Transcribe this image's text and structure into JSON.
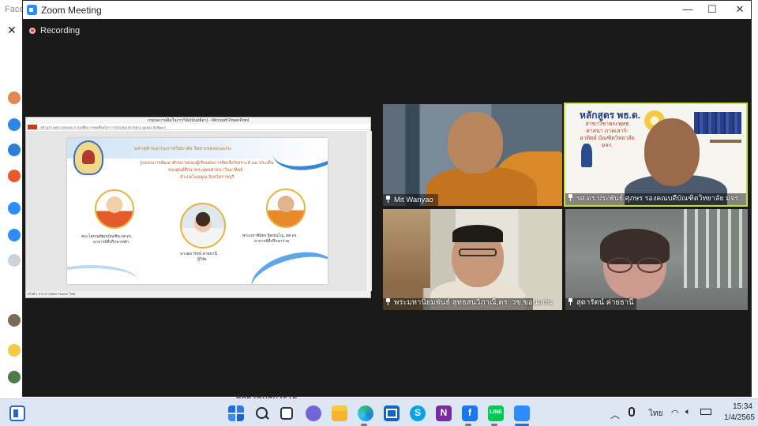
{
  "window": {
    "title": "Zoom Meeting",
    "minimize": "—",
    "maximize": "☐",
    "close": "✕"
  },
  "recording": {
    "label": "Recording"
  },
  "background": {
    "tab_text": "Faceb",
    "close": "✕",
    "bottom_text": "หลอรัชกลีกระโจ"
  },
  "shared_screen": {
    "app_title": "กรอบความคิดในการวิจัย(นันทธิดา) - Microsoft PowerPoint",
    "ribbon_tabs": "หน้าแรก   แทรก   ออกแบบ   การเปลี่ยน   ภาพเคลื่อนไหว   การนำเสนอ   ตรวจทาน   มุมมอง   นักพัฒนา",
    "status": "สไลด์ 1 จาก 8   \"Office Theme\"   ไทย",
    "slide": {
      "header": "มหาจุฬาลงกรณราชวิทยาลัย วิทยาเขตขอนแก่น",
      "line1": "รูปแบบการพัฒนาศักยภาพของผู้เรียนต่อการคิดเชิงวิเคราะห์ ๔๓ ประเด็น",
      "line2": "ของศูนย์ศึกษาพระพุทธศาสนาวันอาทิตย์",
      "line3": "อำเภอโนนคูณ จังหวัดราชบุรี",
      "person1_name": "พระโสภณพัฒนบัณฑิต,รศ.ดร.",
      "person1_role": "อาจารย์ที่ปรึกษาหลัก",
      "person2_name": "นางสุดารัตน์ ค่ายธานี",
      "person2_role": "ผู้วิจัย",
      "person3_name": "พระมหาพิมิตร ฐิตปญฺโญ, ผศ.ดร.",
      "person3_role": "อาจารย์ที่ปรึกษาร่วม"
    }
  },
  "participants": [
    {
      "name": "Mit Wanyao"
    },
    {
      "name": "รศ.ดร.ประพันธ์ ศุภษร รองคณบดีบัณฑิตวิทยาลัย มจร",
      "poster_title": "หลักสูตร พธ.ด.",
      "poster_sub": "สาขาวิชาพระพุทธศาสนา ภาคเสาร์-อาทิตย์ บัณฑิตวิทยาลัย มจร."
    },
    {
      "name": "พระมหานิยมพันธ์ สุทธสนวิภาณี,ดร. วข.ขอนแก่น"
    },
    {
      "name": "สุดารัตน์ ค่ายธานี"
    }
  ],
  "taskbar": {
    "language": "ไทย",
    "time": "15:34",
    "date": "1/4/2565"
  },
  "colors": {
    "accent": "#2d8cff",
    "active_speaker": "#c6e03a",
    "recording": "#e04848"
  }
}
